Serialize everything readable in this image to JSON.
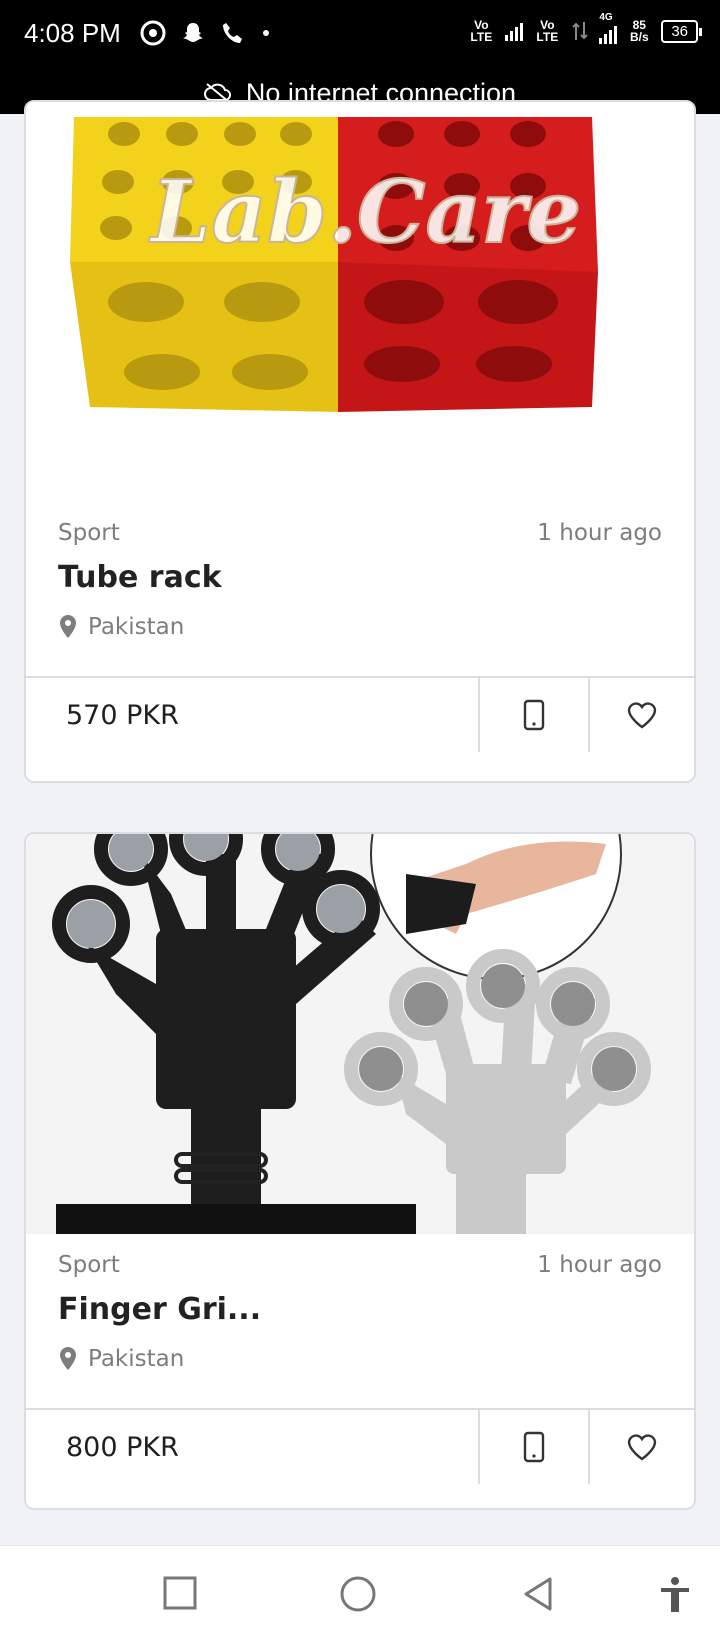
{
  "status_bar": {
    "time": "4:08 PM",
    "net_speed_value": "85",
    "net_speed_unit": "B/s",
    "battery": "36",
    "sim1": "Vo LTE",
    "sim2": "Vo LTE",
    "network_type": "4G"
  },
  "offline_banner": {
    "text": "No internet connection",
    "icon": "cloud-off-icon"
  },
  "listings": [
    {
      "category": "Sport",
      "time": "1 hour ago",
      "title": "Tube rack",
      "location": "Pakistan",
      "price": "570 PKR",
      "watermark": "Lab.Care"
    },
    {
      "category": "Sport",
      "time": "1 hour ago",
      "title": "Finger Gri...",
      "location": "Pakistan",
      "price": "800 PKR"
    }
  ],
  "nav_bar": {
    "buttons": [
      "recent-apps-icon",
      "home-icon",
      "back-icon",
      "accessibility-icon"
    ]
  },
  "colors": {
    "accent_dark": "#000000",
    "border": "#dcdde2",
    "muted_text": "#7d7d7d",
    "rack_yellow": "#f2d21b",
    "rack_red": "#d51d1d"
  }
}
